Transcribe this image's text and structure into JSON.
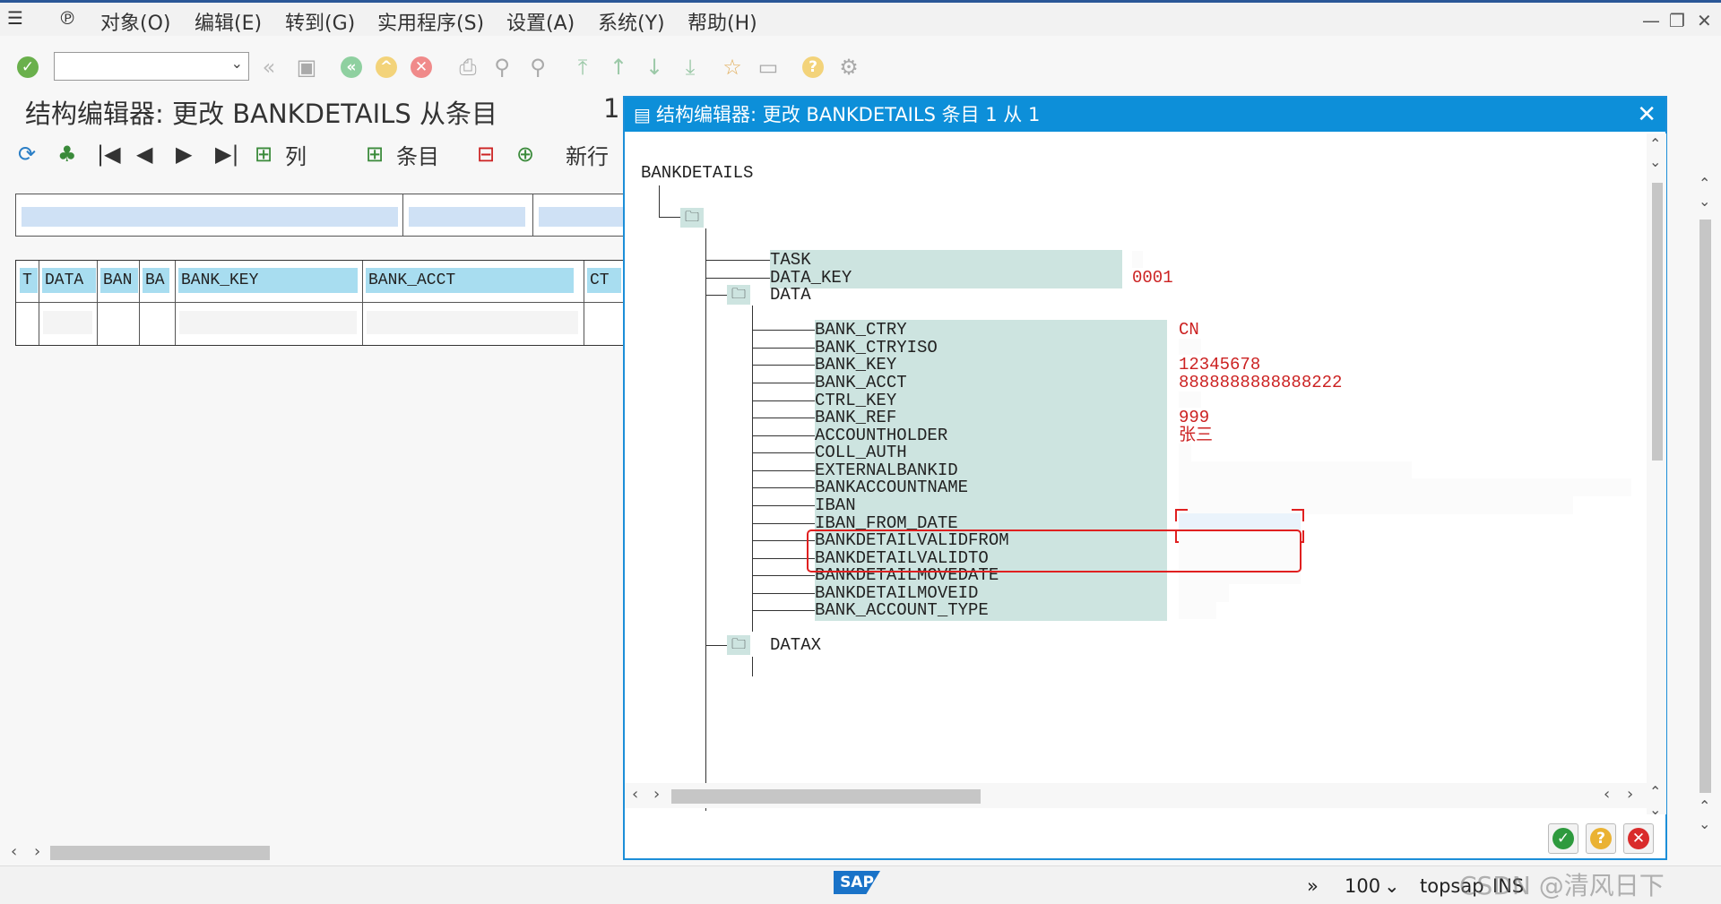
{
  "menubar": {
    "items": [
      "对象(O)",
      "编辑(E)",
      "转到(G)",
      "实用程序(S)",
      "设置(A)",
      "系统(Y)",
      "帮助(H)"
    ]
  },
  "background": {
    "title": "结构编辑器: 更改 BANKDETAILS 从条目",
    "title_num": "1",
    "toolbar": {
      "col_label": "列",
      "entry_label": "条目",
      "newline_label": "新行"
    },
    "table_headers": [
      "T",
      "DATA",
      "BAN",
      "BA",
      "BANK_KEY",
      "BANK_ACCT",
      "CT"
    ]
  },
  "dialog": {
    "title": "结构编辑器: 更改 BANKDETAILS 条目 1 从 1",
    "root": "BANKDETAILS",
    "nodes": [
      {
        "key": "TASK",
        "value": ""
      },
      {
        "key": "DATA_KEY",
        "value": "0001"
      },
      {
        "key": "DATA",
        "value": ""
      }
    ],
    "data_fields": [
      {
        "key": "BANK_CTRY",
        "value": "CN"
      },
      {
        "key": "BANK_CTRYISO",
        "value": ""
      },
      {
        "key": "BANK_KEY",
        "value": "12345678"
      },
      {
        "key": "BANK_ACCT",
        "value": "8888888888888222"
      },
      {
        "key": "CTRL_KEY",
        "value": ""
      },
      {
        "key": "BANK_REF",
        "value": "999"
      },
      {
        "key": "ACCOUNTHOLDER",
        "value": "张三"
      },
      {
        "key": "COLL_AUTH",
        "value": ""
      },
      {
        "key": "EXTERNALBANKID",
        "value": ""
      },
      {
        "key": "BANKACCOUNTNAME",
        "value": ""
      },
      {
        "key": "IBAN",
        "value": ""
      },
      {
        "key": "IBAN_FROM_DATE",
        "value": ""
      },
      {
        "key": "BANKDETAILVALIDFROM",
        "value": ""
      },
      {
        "key": "BANKDETAILVALIDTO",
        "value": ""
      },
      {
        "key": "BANKDETAILMOVEDATE",
        "value": ""
      },
      {
        "key": "BANKDETAILMOVEID",
        "value": ""
      },
      {
        "key": "BANK_ACCOUNT_TYPE",
        "value": ""
      }
    ],
    "datax": "DATAX"
  },
  "statusbar": {
    "logo": "SAP",
    "zoom": "100",
    "system": "topsap",
    "mode": "INS",
    "watermark": "CSDN @清风日下"
  },
  "colors": {
    "accent": "#0d8fd9",
    "value_red": "#cc2222",
    "highlight_box": "#e02020"
  }
}
